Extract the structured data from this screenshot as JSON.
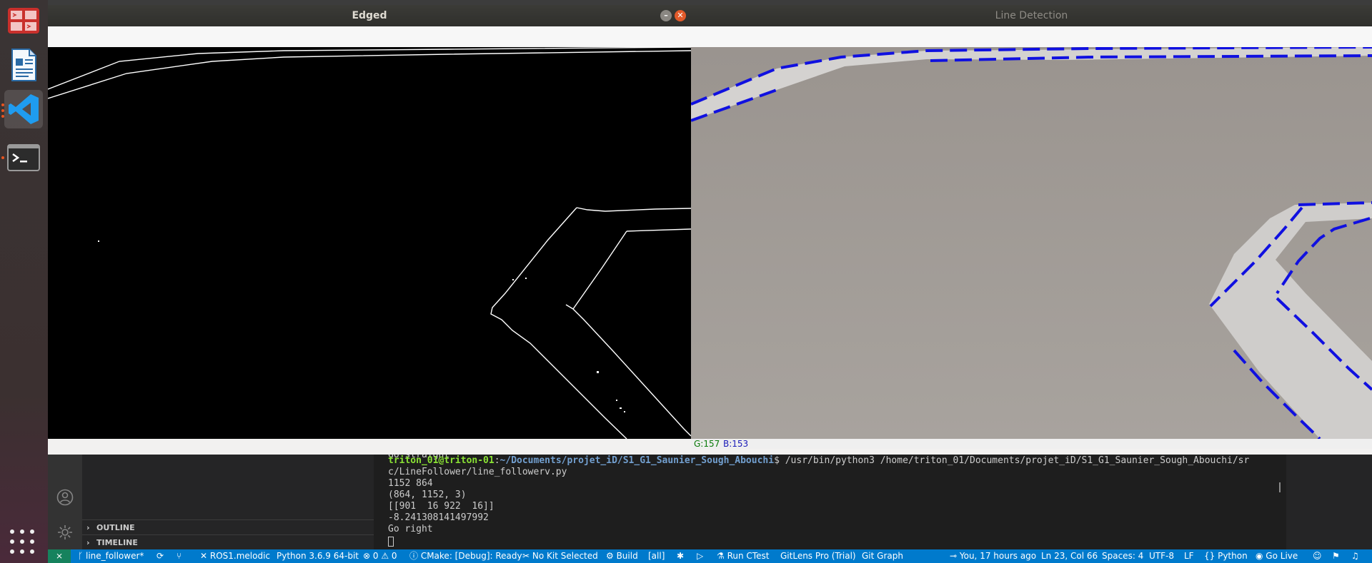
{
  "dock": {
    "items": [
      {
        "name": "remmina-icon",
        "running": false
      },
      {
        "name": "libreoffice-writer-icon",
        "running": false
      },
      {
        "name": "vscode-icon",
        "running": true
      },
      {
        "name": "terminal-icon",
        "running": true
      }
    ]
  },
  "edged_window": {
    "title": "Edged"
  },
  "detection_window": {
    "title": "Line Detection",
    "status_g": "G:157",
    "status_b": "B:153"
  },
  "terminal": {
    "partial_top": "Go straight",
    "prompt_user": "triton_01@triton-01",
    "prompt_sep": ":",
    "prompt_path": "~/Documents/projet_iD/S1_G1_Saunier_Sough_Abouchi",
    "command": "$ /usr/bin/python3 /home/triton_01/Documents/projet_iD/S1_G1_Saunier_Sough_Abouchi/sr",
    "command_wrap": "c/LineFollower/line_followerv.py",
    "output": [
      "1152 864",
      "(864, 1152, 3)",
      "[[901  16 922  16]]",
      "-8.241308141497992",
      "Go right"
    ]
  },
  "sidebar": {
    "sections": [
      "OUTLINE",
      "TIMELINE"
    ]
  },
  "statusbar": {
    "branch": "line_follower*",
    "ros": "ROS1.melodic",
    "python": "Python 3.6.9 64-bit",
    "errors": "0",
    "warnings": "0",
    "cmake": "CMake: [Debug]: Ready",
    "kit": "No Kit Selected",
    "build": "Build",
    "all": "[all]",
    "ctest": "Run CTest",
    "gitlens": "GitLens Pro (Trial)",
    "gitgraph": "Git Graph",
    "blame": "You, 17 hours ago",
    "position": "Ln 23, Col 66",
    "spaces": "Spaces: 4",
    "encoding": "UTF-8",
    "eol": "LF",
    "language": "Python",
    "golive": "Go Live"
  }
}
